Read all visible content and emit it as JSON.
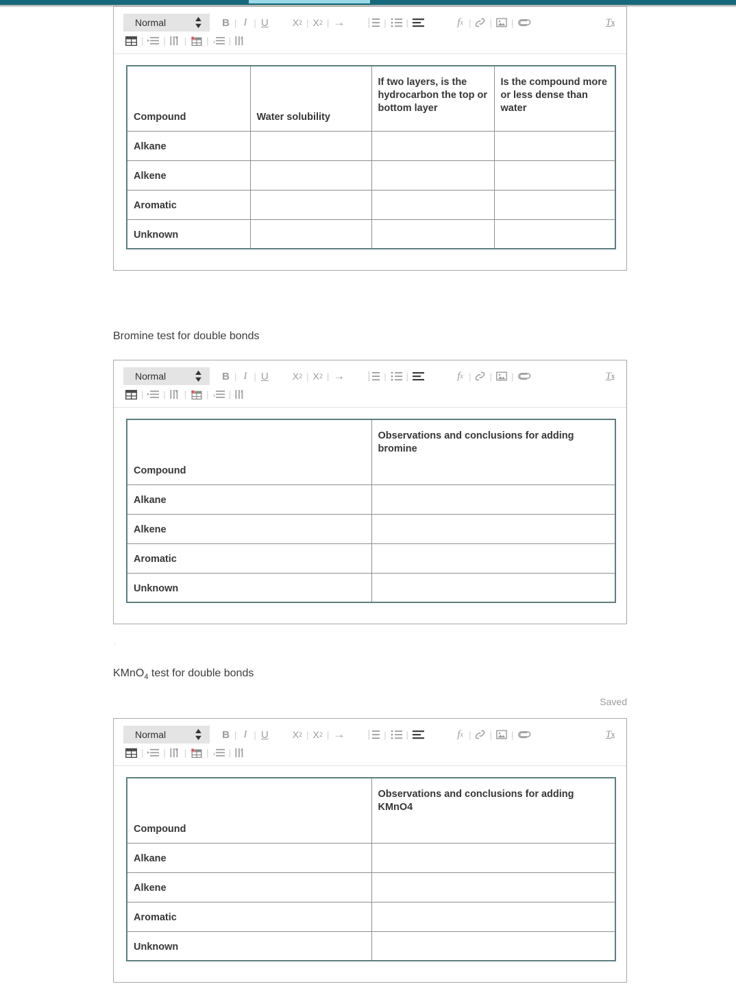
{
  "appbar": {
    "color": "#15697a",
    "progress_color": "#9ad9e8"
  },
  "toolbar": {
    "format_select_value": "Normal",
    "buttons": [
      {
        "name": "bold",
        "label": "B"
      },
      {
        "name": "italic",
        "label": "I"
      },
      {
        "name": "underline",
        "label": "U"
      },
      {
        "name": "subscript",
        "label": "X2"
      },
      {
        "name": "superscript",
        "label": "X2"
      },
      {
        "name": "indent-arrow",
        "label": "→"
      },
      {
        "name": "numbered-list",
        "label": "numbered-list"
      },
      {
        "name": "bulleted-list",
        "label": "bulleted-list"
      },
      {
        "name": "align",
        "label": "align"
      },
      {
        "name": "formula",
        "label": "fx"
      },
      {
        "name": "link",
        "label": "link"
      },
      {
        "name": "image",
        "label": "image"
      },
      {
        "name": "attachment",
        "label": "attachment"
      },
      {
        "name": "clear-formatting",
        "label": "Tx"
      },
      {
        "name": "insert-table",
        "label": "insert-table"
      },
      {
        "name": "insert-row",
        "label": "insert-row"
      },
      {
        "name": "insert-column",
        "label": "insert-column"
      },
      {
        "name": "delete-table",
        "label": "delete-table"
      },
      {
        "name": "delete-row",
        "label": "delete-row"
      },
      {
        "name": "delete-column",
        "label": "delete-column"
      }
    ]
  },
  "sections": [
    {
      "id": "solubility",
      "heading": null,
      "table": {
        "headers": [
          "Compound",
          "Water solubility",
          "If two layers, is the hydrocarbon the top or bottom layer",
          "Is the compound more or less dense than water"
        ],
        "rows": [
          {
            "compound": "Alkane",
            "cells": [
              "",
              "",
              ""
            ]
          },
          {
            "compound": "Alkene",
            "cells": [
              "",
              "",
              ""
            ]
          },
          {
            "compound": "Aromatic",
            "cells": [
              "",
              "",
              ""
            ]
          },
          {
            "compound": "Unknown",
            "cells": [
              "",
              "",
              ""
            ]
          }
        ]
      }
    },
    {
      "id": "bromine",
      "heading": "Bromine test for double bonds",
      "table": {
        "headers": [
          "Compound",
          "Observations and conclusions for adding bromine"
        ],
        "rows": [
          {
            "compound": "Alkane",
            "cells": [
              ""
            ]
          },
          {
            "compound": "Alkene",
            "cells": [
              ""
            ]
          },
          {
            "compound": "Aromatic",
            "cells": [
              ""
            ]
          },
          {
            "compound": "Unknown",
            "cells": [
              ""
            ]
          }
        ]
      }
    },
    {
      "id": "kmno4",
      "heading_prefix": "KMnO",
      "heading_sub": "4",
      "heading_suffix": " test for double bonds",
      "status": "Saved",
      "table": {
        "headers": [
          "Compound",
          "Observations and conclusions for adding KMnO4"
        ],
        "rows": [
          {
            "compound": "Alkane",
            "cells": [
              ""
            ]
          },
          {
            "compound": "Alkene",
            "cells": [
              ""
            ]
          },
          {
            "compound": "Aromatic",
            "cells": [
              ""
            ]
          },
          {
            "compound": "Unknown",
            "cells": [
              ""
            ]
          }
        ]
      }
    }
  ],
  "artifact_dot": "."
}
